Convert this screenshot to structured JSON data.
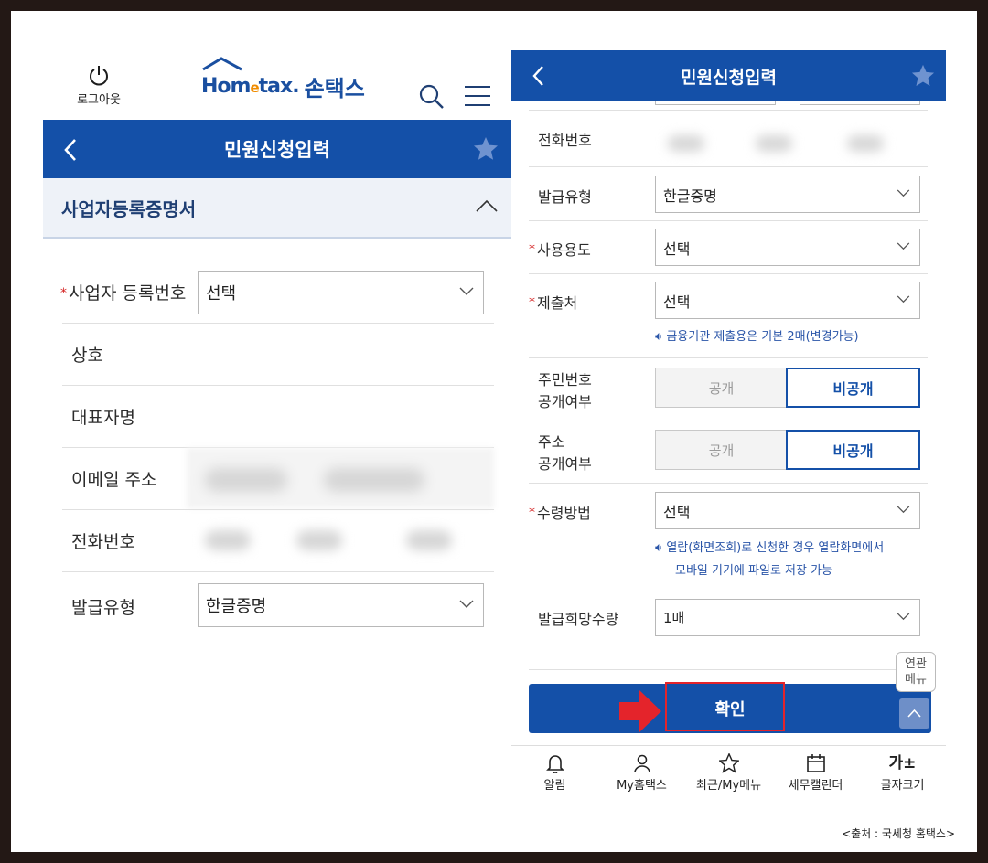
{
  "left": {
    "logout_label": "로그아웃",
    "logo_home": "Hom",
    "logo_e": "e",
    "logo_tax": "tax.",
    "logo_son": "손택스",
    "header_title": "민원신청입력",
    "section_title": "사업자등록증명서",
    "rows": {
      "biz_no_label": "사업자 등록번호",
      "biz_no_value": "선택",
      "company_label": "상호",
      "rep_label": "대표자명",
      "email_label": "이메일 주소",
      "phone_label": "전화번호",
      "issue_type_label": "발급유형",
      "issue_type_value": "한글증명"
    },
    "required_mark": "*"
  },
  "right": {
    "header_title": "민원신청입력",
    "phone_label": "전화번호",
    "issue_type_label": "발급유형",
    "issue_type_value": "한글증명",
    "usage_label": "사용용도",
    "usage_value": "선택",
    "submit_to_label": "제출처",
    "submit_to_value": "선택",
    "submit_notice": "금융기관 제출용은 기본 2매(변경가능)",
    "rrn_label_1": "주민번호",
    "rrn_label_2": "공개여부",
    "addr_label_1": "주소",
    "addr_label_2": "공개여부",
    "public_label": "공개",
    "private_label": "비공개",
    "receive_label": "수령방법",
    "receive_value": "선택",
    "receive_notice_1": "열람(화면조회)로 신청한 경우 열람화면에서",
    "receive_notice_2": "모바일 기기에 파일로 저장 가능",
    "qty_label": "발급희망수량",
    "qty_value": "1매",
    "confirm_label": "확인",
    "related_1": "연관",
    "related_2": "메뉴",
    "tabs": [
      "알림",
      "My홈택스",
      "최근/My메뉴",
      "세무캘린더",
      "글자크기"
    ],
    "font_icon_text": "가±",
    "required_mark": "*"
  },
  "source": "<출처 : 국세청 홈택스>",
  "colors": {
    "primary": "#1450a8",
    "required": "#d42020",
    "highlight": "#e4242b"
  }
}
